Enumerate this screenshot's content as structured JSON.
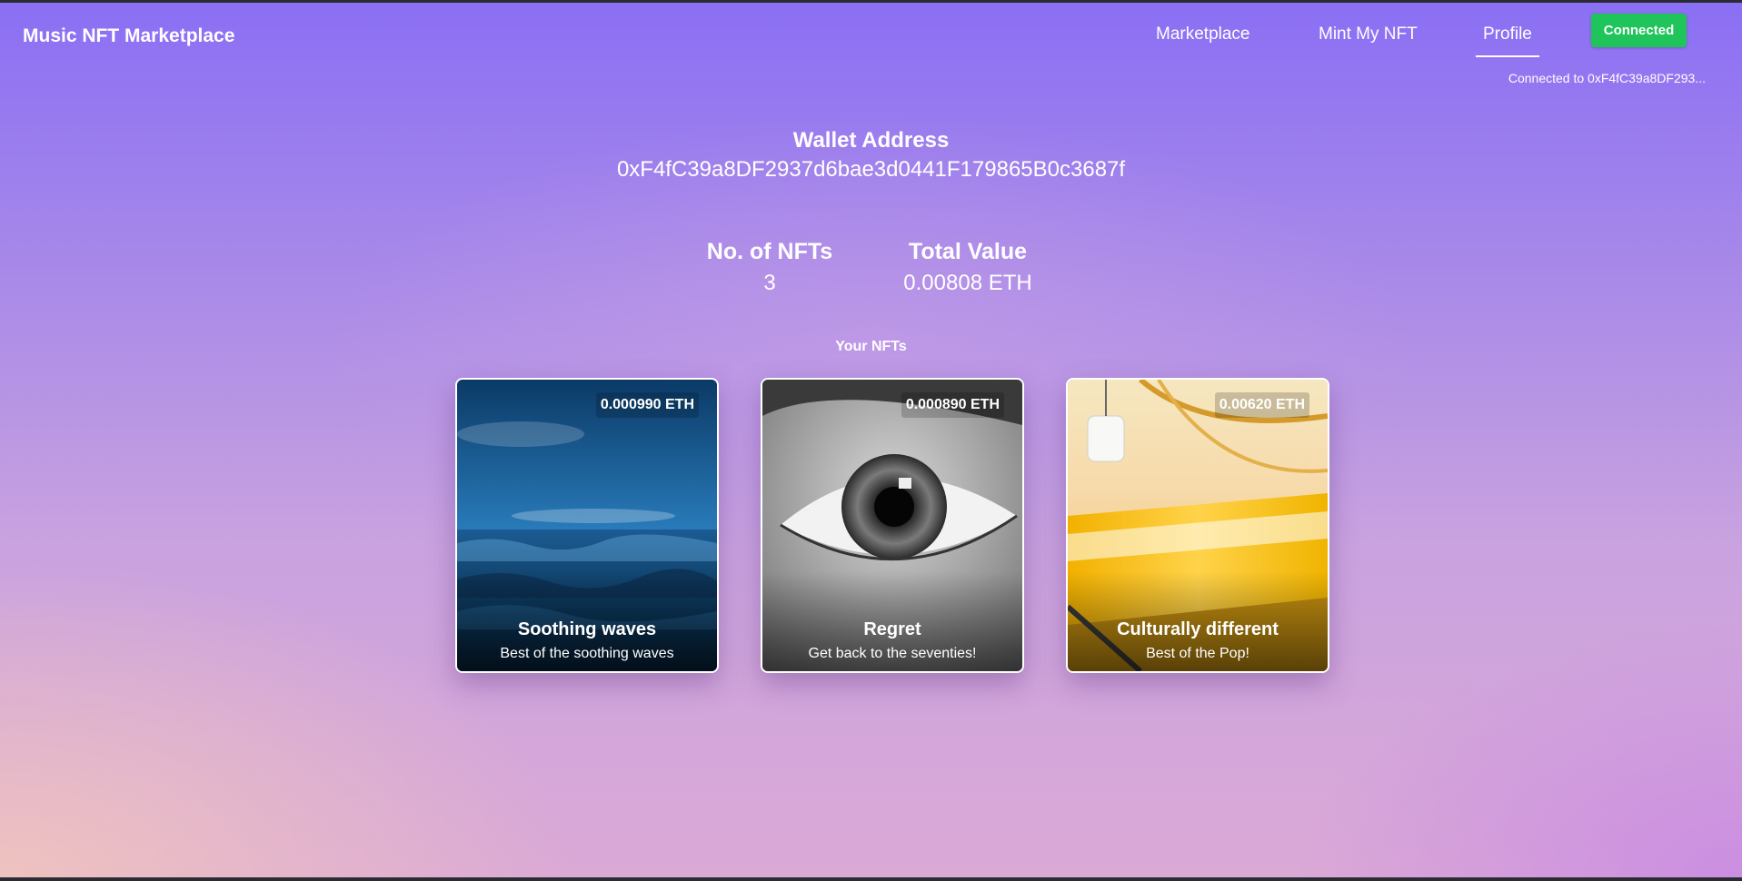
{
  "header": {
    "brand": "Music NFT Marketplace",
    "nav": [
      "Marketplace",
      "Mint My NFT",
      "Profile"
    ],
    "active_nav": "Profile",
    "connect_button": "Connected",
    "connected_text": "Connected to 0xF4fC39a8DF293..."
  },
  "wallet": {
    "title": "Wallet Address",
    "address": "0xF4fC39a8DF2937d6bae3d0441F179865B0c3687f"
  },
  "stats": {
    "nfts_label": "No. of NFTs",
    "nfts_value": "3",
    "value_label": "Total Value",
    "value_value": "0.00808 ETH"
  },
  "section_title": "Your NFTs",
  "nfts": [
    {
      "price": "0.000990 ETH",
      "title": "Soothing waves",
      "description": "Best of the soothing waves",
      "image": "ocean-waves"
    },
    {
      "price": "0.000890 ETH",
      "title": "Regret",
      "description": "Get back to the seventies!",
      "image": "black-white-eye"
    },
    {
      "price": "0.00620 ETH",
      "title": "Culturally different",
      "description": "Best of the Pop!",
      "image": "yellow-train-station"
    }
  ],
  "colors": {
    "accent_green": "#1fc45a",
    "gradient_top": "#8b6ff4",
    "gradient_bottom": "#dba9d6"
  }
}
